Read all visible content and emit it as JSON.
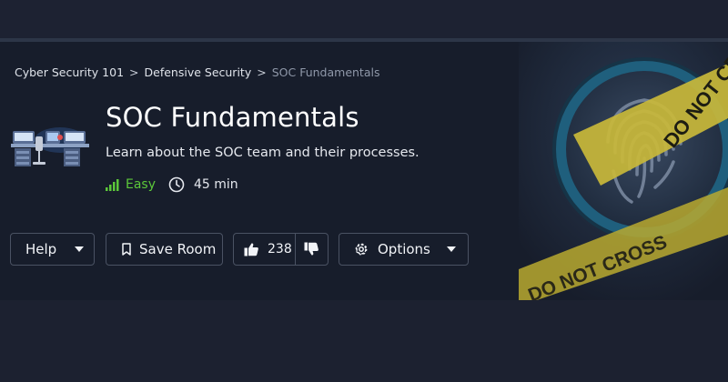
{
  "breadcrumb": {
    "items": [
      "Cyber Security 101",
      "Defensive Security"
    ],
    "current": "SOC Fundamentals",
    "separator": ">"
  },
  "room": {
    "title": "SOC Fundamentals",
    "description": "Learn about the SOC team and their processes.",
    "difficulty": "Easy",
    "duration": "45 min",
    "icon": "soc-workstation-icon"
  },
  "hero_art": {
    "icon": "fingerprint-magnifier-icon",
    "tape_text_1": "DO NOT CROSS",
    "tape_text_2": "DO NOT CROSS"
  },
  "actions": {
    "help_label": "Help",
    "save_label": "Save Room",
    "like_count": "238",
    "options_label": "Options"
  },
  "colors": {
    "background": "#1c2130",
    "hero": "#171d2b",
    "easy_green": "#5cc73a",
    "button_border": "#4a5263",
    "tape_yellow": "#c9b93a"
  }
}
